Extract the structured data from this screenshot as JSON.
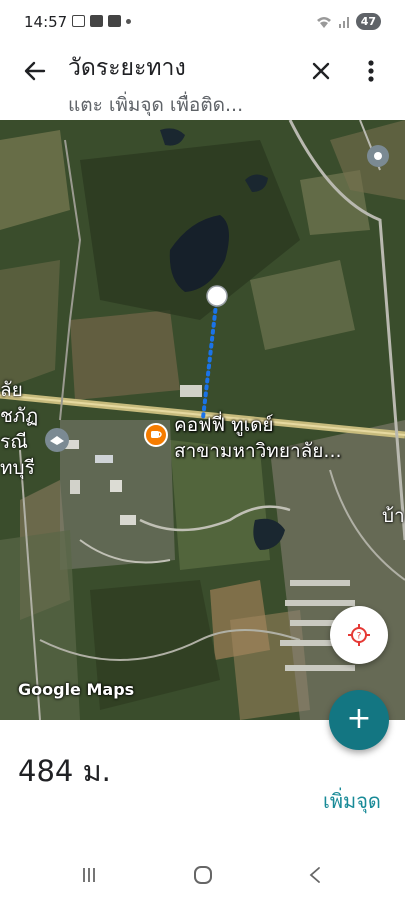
{
  "status_bar": {
    "time": "14:57",
    "battery": "47",
    "left_icons": [
      "screenshot-icon",
      "facebook-icon",
      "youtube-icon",
      "dot-icon"
    ],
    "right_icons": [
      "wifi-icon",
      "signal-icon",
      "battery-icon"
    ]
  },
  "header": {
    "title": "วัดระยะทาง",
    "subtitle": "แตะ เพิ่มจุด เพื่อติด...",
    "back_icon": "arrow-left-icon",
    "close_icon": "close-icon",
    "more_icon": "more-vert-icon"
  },
  "map": {
    "poi_name_line1": "คอฟฟี่ ทูเดย์",
    "poi_name_line2": "สาขามหาวิทยาลัย...",
    "edge_text_1": "ลัย",
    "edge_text_2": "ชภัฏ",
    "edge_text_3": "รณี",
    "edge_text_4": "ทบุรี",
    "edge_text_5": "บ้า",
    "attribution": "Google Maps",
    "measure_line_color": "#1a73e8",
    "poi_color": "#f57c00"
  },
  "measurement": {
    "distance": "484 ม.",
    "add_point_label": "เพิ่มจุด",
    "accent": "#137682"
  },
  "nav": {
    "icons": [
      "recents-icon",
      "home-icon",
      "back-icon"
    ]
  }
}
